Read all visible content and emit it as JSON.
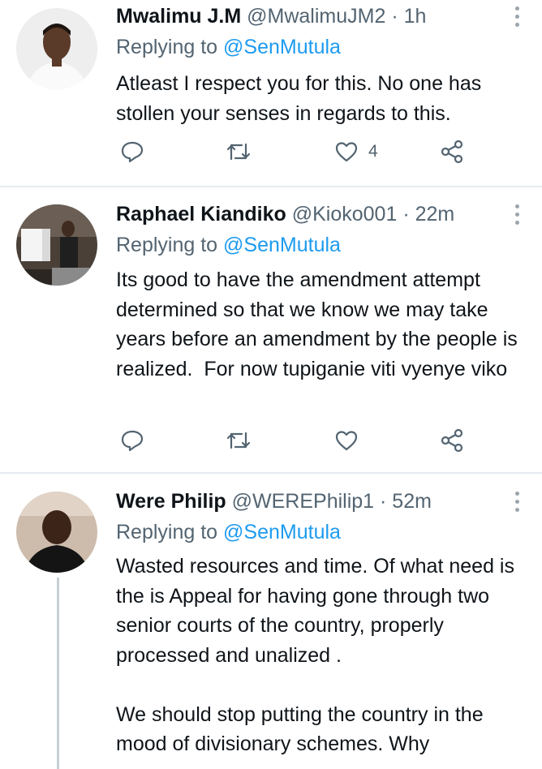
{
  "tweets": [
    {
      "name": "Mwalimu J.M",
      "handle": "@MwalimuJM2",
      "time": "· 1h",
      "replying_prefix": "Replying to",
      "replying_to": "@SenMutula",
      "text": "Atleast I respect you for this. No one has stollen your senses in regards to this.",
      "like_count": "4",
      "avatar_colors": {
        "bg": "#f2f2f2",
        "skin": "#5a3a28",
        "shirt": "#f8f8f8"
      }
    },
    {
      "name": "Raphael Kiandiko",
      "handle": "@Kioko001",
      "time": "· 22m",
      "replying_prefix": "Replying to",
      "replying_to": "@SenMutula",
      "text": "Its good to have the amendment attempt determined so that we know we may take years before an amendment by the people is realized.  For now tupiganie viti vyenye viko",
      "like_count": "",
      "avatar_colors": {
        "bg": "#3b3530",
        "skin": "#4a3324",
        "shirt": "#2a2a2a"
      }
    },
    {
      "name": "Were Philip",
      "handle": "@WEREPhilip1",
      "time": "· 52m",
      "replying_prefix": "Replying to",
      "replying_to": "@SenMutula",
      "text": "Wasted resources and time. Of what need is the is Appeal for having gone through two senior courts of the country, properly processed and unalized .\n\nWe should stop putting the country in the mood of divisionary schemes. Why",
      "avatar_colors": {
        "bg": "#c9b7a6",
        "skin": "#3d2418",
        "shirt": "#141414"
      }
    }
  ],
  "icons": [
    "reply-icon",
    "retweet-icon",
    "like-icon",
    "share-icon",
    "more-icon"
  ],
  "colors": {
    "accent": "#1d9bf0",
    "muted": "#536471",
    "text": "#0f1419",
    "divider": "#e6ecf0"
  }
}
